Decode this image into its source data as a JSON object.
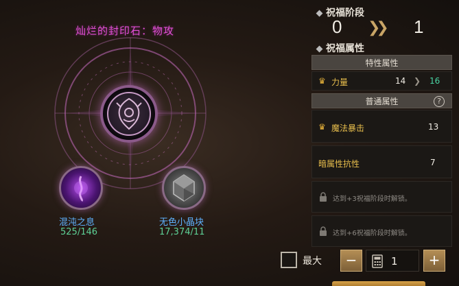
{
  "stone": {
    "title": "灿烂的封印石：物攻",
    "emblem_icon": "seal-emblem-icon"
  },
  "materials": [
    {
      "name": "混沌之息",
      "count": "525/146",
      "icon": "chaos-breath-icon",
      "color": "#5fb2ff"
    },
    {
      "name": "无色小晶块",
      "count": "17,374/11",
      "icon": "colorless-crystal-icon",
      "color": "#5fb2ff"
    }
  ],
  "blessing_stage": {
    "heading": "祝福阶段",
    "current": "0",
    "next": "1",
    "arrow_icon": "double-chevron-right-icon"
  },
  "blessing_attributes": {
    "heading": "祝福属性",
    "special_header": "特性属性",
    "special_rows": [
      {
        "label": "力量",
        "from": "14",
        "to": "16",
        "icon": "crown-icon"
      }
    ],
    "normal_header": "普通属性",
    "help_icon": "question-icon",
    "normal_rows": [
      {
        "label": "魔法暴击",
        "value": "13",
        "icon": "crown-icon"
      },
      {
        "label": "暗属性抗性",
        "value": "7"
      }
    ],
    "locked_rows": [
      {
        "text": "达到+3祝福阶段时解锁。",
        "icon": "lock-icon"
      },
      {
        "text": "达到+6祝福阶段时解锁。",
        "icon": "lock-icon"
      }
    ]
  },
  "controls": {
    "max_label": "最大",
    "minus_label": "−",
    "plus_label": "+",
    "quantity": "1",
    "calculator_icon": "calculator-icon"
  },
  "colors": {
    "title_magenta": "#e24fd7",
    "material_blue": "#5fb2ff",
    "count_green": "#5ed196",
    "gold": "#e9bf4d",
    "upgrade_green": "#49d6a4"
  }
}
